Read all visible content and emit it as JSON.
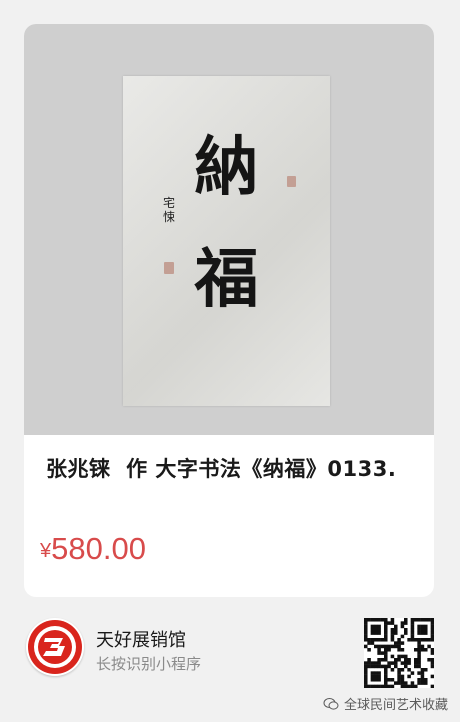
{
  "product": {
    "artwork_characters": [
      "納",
      "福"
    ],
    "artwork_signature": "宅悚",
    "title": "张兆铼  作 大字书法《纳福》0133.",
    "price_currency": "¥",
    "price_amount": "580.00"
  },
  "footer": {
    "logo_icon": "three-ribbon-logo-icon",
    "store_name": "天好展销馆",
    "store_subtitle": "长按识别小程序",
    "qr_icon": "qr-code-icon"
  },
  "watermark": {
    "icon": "wechat-icon",
    "text": "全球民间艺术收藏"
  },
  "colors": {
    "price": "#d84b4b",
    "logo_red": "#d9251d",
    "background": "#f1f1f1"
  }
}
